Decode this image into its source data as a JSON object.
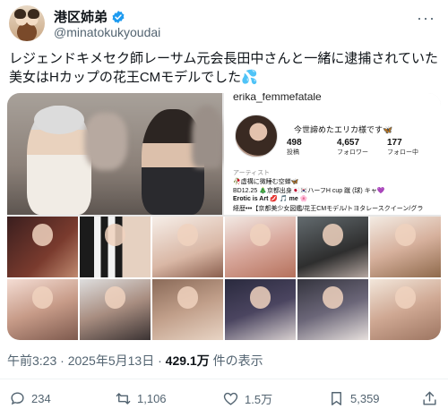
{
  "author": {
    "display_name": "港区姉弟",
    "handle": "@minatokukyoudai",
    "verified": true
  },
  "tweet": {
    "text": "レジェンドキメセク師レーサム元会長田中さんと一緒に逮捕されていた美女はHカップの花王CMモデルでした",
    "emoji": "💦"
  },
  "instagram_profile": {
    "username": "erika_femmefatale",
    "bio_top": "今世諦めたエリカ様です🦋",
    "stats": [
      {
        "value": "498",
        "label": "投稿"
      },
      {
        "value": "4,657",
        "label": "フォロワー"
      },
      {
        "value": "177",
        "label": "フォロー中"
      }
    ],
    "category": "アーティスト",
    "bio_lines": [
      "🥀虚構に微睡む空蝉🦋",
      "BD12.25 🎄京都出身🇯🇵🇰🇷ハーフH cup 蹴 (球) キャ💜",
      "Erotic is Art 💋 🎵 me 🌸",
      "経歴•••【京都美少女図鑑/花王CMモデル/トヨタレースクイーン/グラ"
    ]
  },
  "meta": {
    "time": "午前3:23",
    "date": "2025年5月13日",
    "views_value": "429.1万",
    "views_label": "件の表示"
  },
  "actions": {
    "reply_count": "234",
    "retweet_count": "1,106",
    "like_count": "1.5万",
    "bookmark_count": "5,359"
  },
  "colors": {
    "text": "#0f1419",
    "secondary": "#536471",
    "verified": "#1d9bf0"
  }
}
